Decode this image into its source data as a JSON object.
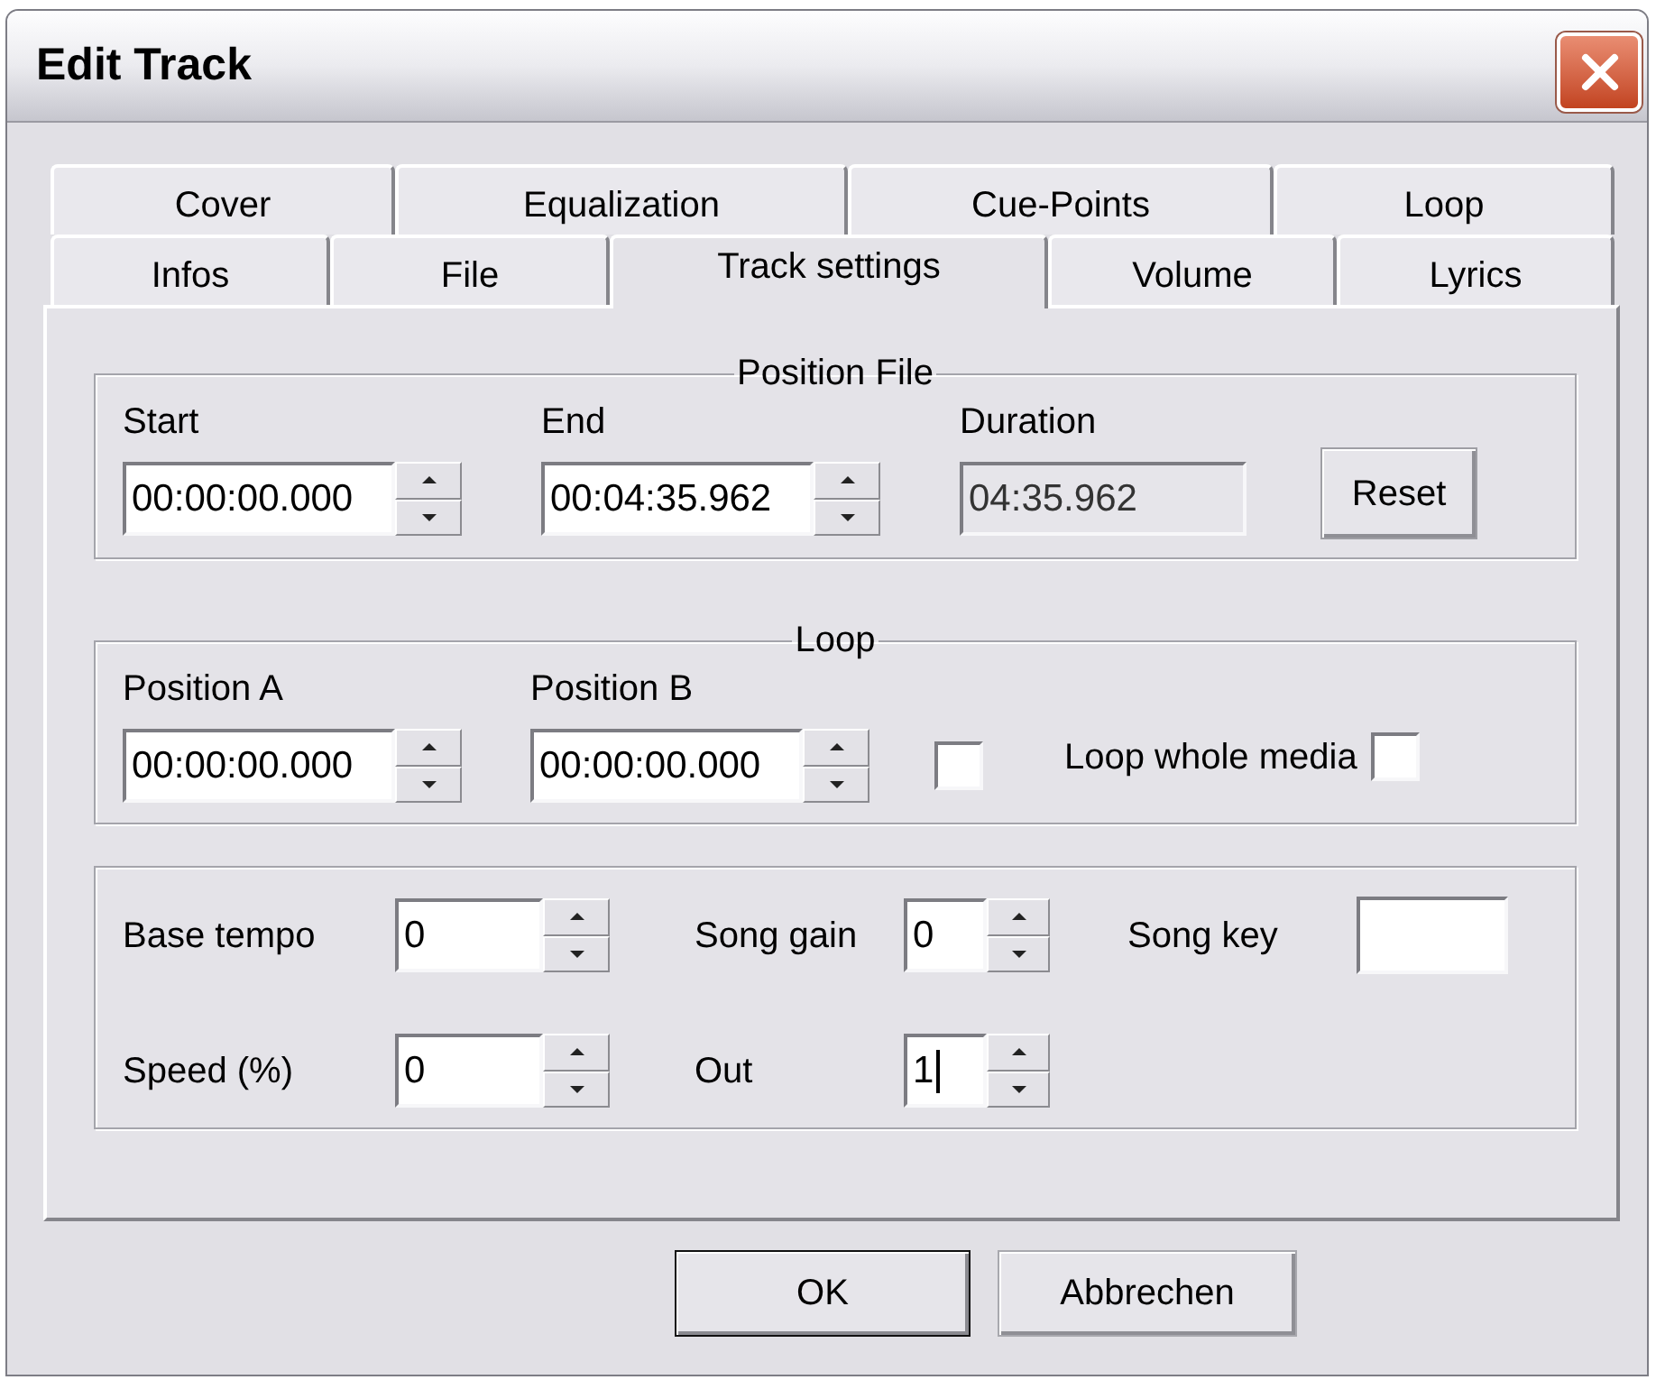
{
  "window": {
    "title": "Edit Track"
  },
  "tab_rows": [
    {
      "tabs": [
        {
          "label": "Cover",
          "selected": false
        },
        {
          "label": "Equalization",
          "selected": false
        },
        {
          "label": "Cue-Points",
          "selected": false
        },
        {
          "label": "Loop",
          "selected": false
        }
      ]
    },
    {
      "tabs": [
        {
          "label": "Infos",
          "selected": false
        },
        {
          "label": "File",
          "selected": false
        },
        {
          "label": "Track settings",
          "selected": true
        },
        {
          "label": "Volume",
          "selected": false
        },
        {
          "label": "Lyrics",
          "selected": false
        }
      ]
    }
  ],
  "position_file": {
    "title": "Position File",
    "fields": [
      {
        "kind": "spin",
        "label": "Start",
        "value": "00:00:00.000"
      },
      {
        "kind": "spin",
        "label": "End",
        "value": "00:04:35.962"
      },
      {
        "kind": "readonly",
        "label": "Duration",
        "value": "04:35.962"
      }
    ],
    "reset_button": "Reset"
  },
  "loop": {
    "title": "Loop",
    "fields": [
      {
        "kind": "spin",
        "label": "Position A",
        "value": "00:00:00.000"
      },
      {
        "kind": "spin",
        "label": "Position B",
        "value": "00:00:00.000"
      }
    ],
    "loop_checkbox": {
      "checked": false
    },
    "loop_whole_media": {
      "label": "Loop whole media",
      "checked": false
    }
  },
  "playback": {
    "rows": [
      {
        "fields": [
          {
            "kind": "spin",
            "label": "Base tempo",
            "value": "0",
            "focused": false
          },
          {
            "kind": "spin",
            "label": "Song gain",
            "value": "0",
            "focused": false
          },
          {
            "kind": "text",
            "label": "Song key",
            "focused": false
          }
        ]
      },
      {
        "fields": [
          {
            "kind": "spin",
            "label": "Speed (%)",
            "value": "0",
            "focused": false
          },
          {
            "kind": "spin",
            "label": "Out",
            "value": "1",
            "focused": true
          }
        ]
      }
    ]
  },
  "buttons": [
    {
      "label": "OK",
      "default": true
    },
    {
      "label": "Abbrechen",
      "default": false
    }
  ]
}
